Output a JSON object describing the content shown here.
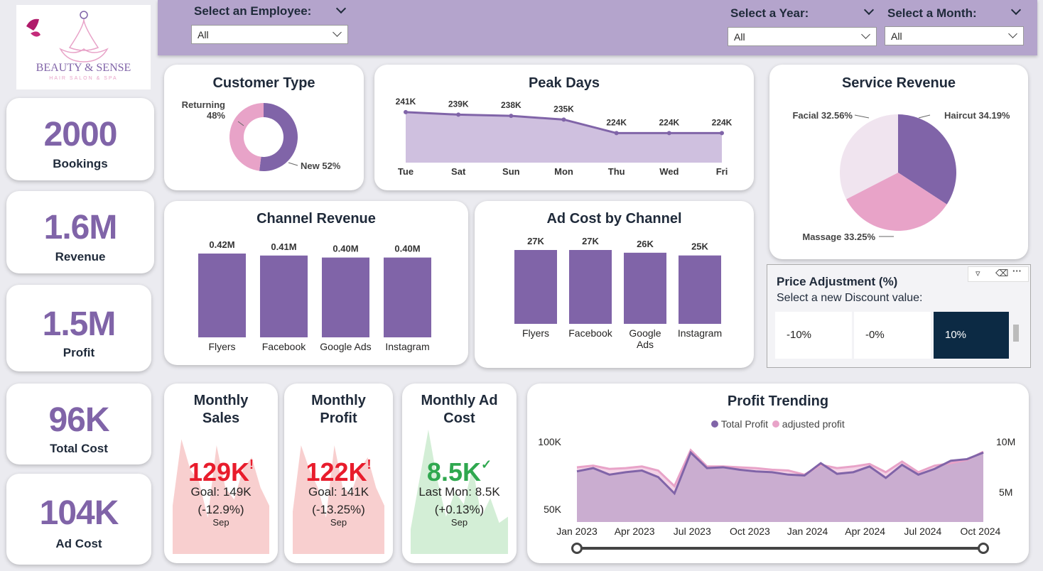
{
  "logo": {
    "brand": "BEAUTY & SENSE",
    "tagline": "HAIR SALON & SPA"
  },
  "filters": {
    "employee": {
      "label": "Select an Employee:",
      "value": "All"
    },
    "year": {
      "label": "Select a Year:",
      "value": "All"
    },
    "month": {
      "label": "Select a Month:",
      "value": "All"
    }
  },
  "kpis": [
    {
      "value": "2000",
      "label": "Bookings"
    },
    {
      "value": "1.6M",
      "label": "Revenue"
    },
    {
      "value": "1.5M",
      "label": "Profit"
    },
    {
      "value": "96K",
      "label": "Total Cost"
    },
    {
      "value": "104K",
      "label": "Ad Cost"
    }
  ],
  "colors": {
    "primary": "#8064a8",
    "pink": "#e8a3c8",
    "light": "#f0e4ef",
    "area": "#cfc0df",
    "navy": "#0c2a44",
    "red": "#e81c2c",
    "green": "#2fa84f"
  },
  "customer_type": {
    "title": "Customer Type",
    "returning_label": "Returning",
    "returning_pct": "48%",
    "new_label": "New 52%"
  },
  "peak_days": {
    "title": "Peak Days"
  },
  "service_revenue": {
    "title": "Service Revenue",
    "facial": "Facial 32.56%",
    "haircut": "Haircut 34.19%",
    "massage": "Massage 33.25%"
  },
  "channel_revenue": {
    "title": "Channel Revenue"
  },
  "ad_cost": {
    "title": "Ad Cost by Channel"
  },
  "price_adjustment": {
    "title": "Price Adjustment (%)",
    "subtitle": "Select a new Discount value:",
    "options": [
      "-10%",
      "-0%",
      "10%"
    ],
    "selected": "10%"
  },
  "monthly_sales": {
    "title": "Monthly Sales",
    "value": "129K",
    "flag": "!",
    "goal": "Goal: 149K",
    "delta": "(-12.9%)",
    "month": "Sep"
  },
  "monthly_profit": {
    "title": "Monthly Profit",
    "value": "122K",
    "flag": "!",
    "goal": "Goal: 141K",
    "delta": "(-13.25%)",
    "month": "Sep"
  },
  "monthly_ad": {
    "title": "Monthly Ad Cost",
    "value": "8.5K",
    "flag": "✓",
    "goal": "Last Mon: 8.5K",
    "delta": "(+0.13%)",
    "month": "Sep"
  },
  "profit_trending": {
    "title": "Profit Trending",
    "legend": [
      "Total Profit",
      "adjusted profit"
    ],
    "y_left": [
      "100K",
      "50K"
    ],
    "y_right": [
      "10M",
      "5M"
    ]
  },
  "chart_data": [
    {
      "type": "pie",
      "title": "Customer Type",
      "labels": [
        "Returning",
        "New"
      ],
      "values": [
        48,
        52
      ]
    },
    {
      "type": "area",
      "title": "Peak Days",
      "categories": [
        "Tue",
        "Sat",
        "Sun",
        "Mon",
        "Thu",
        "Wed",
        "Fri"
      ],
      "values": [
        241,
        239,
        238,
        235,
        224,
        224,
        224
      ],
      "labels": [
        "241K",
        "239K",
        "238K",
        "235K",
        "224K",
        "224K",
        "224K"
      ],
      "ylim": [
        200,
        245
      ]
    },
    {
      "type": "pie",
      "title": "Service Revenue",
      "labels": [
        "Haircut",
        "Massage",
        "Facial"
      ],
      "values": [
        34.19,
        33.25,
        32.56
      ]
    },
    {
      "type": "bar",
      "title": "Channel Revenue",
      "categories": [
        "Flyers",
        "Facebook",
        "Google Ads",
        "Instagram"
      ],
      "values": [
        0.42,
        0.41,
        0.4,
        0.4
      ],
      "labels": [
        "0.42M",
        "0.41M",
        "0.40M",
        "0.40M"
      ]
    },
    {
      "type": "bar",
      "title": "Ad Cost by Channel",
      "categories": [
        "Flyers",
        "Facebook",
        "Google Ads",
        "Instagram"
      ],
      "values": [
        27,
        27,
        26,
        25
      ],
      "labels": [
        "27K",
        "27K",
        "26K",
        "25K"
      ]
    },
    {
      "type": "area",
      "title": "Monthly Sales",
      "values": [
        40,
        95,
        70,
        60,
        30,
        90,
        55,
        45,
        70,
        80,
        55,
        40
      ]
    },
    {
      "type": "area",
      "title": "Monthly Profit",
      "values": [
        35,
        90,
        70,
        55,
        30,
        90,
        55,
        50,
        70,
        80,
        55,
        40
      ]
    },
    {
      "type": "area",
      "title": "Monthly Ad Cost",
      "values": [
        20,
        60,
        100,
        60,
        30,
        50,
        40,
        70,
        30,
        45,
        25,
        30
      ]
    },
    {
      "type": "area",
      "title": "Profit Trending",
      "x_ticks": [
        "Jan 2023",
        "Apr 2023",
        "Jul 2023",
        "Oct 2023",
        "Jan 2024",
        "Apr 2024",
        "Jul 2024",
        "Oct 2024"
      ],
      "series": [
        {
          "name": "Total Profit",
          "values": [
            62,
            66,
            58,
            61,
            63,
            55,
            35,
            85,
            66,
            67,
            64,
            62,
            61,
            58,
            57,
            72,
            59,
            61,
            68,
            54,
            70,
            58,
            65,
            75,
            77,
            85
          ]
        },
        {
          "name": "adjusted profit",
          "values": [
            67,
            69,
            65,
            66,
            68,
            63,
            44,
            88,
            68,
            68,
            67,
            66,
            64,
            63,
            58,
            70,
            66,
            68,
            71,
            61,
            74,
            61,
            69,
            72,
            76,
            86
          ]
        }
      ]
    }
  ]
}
